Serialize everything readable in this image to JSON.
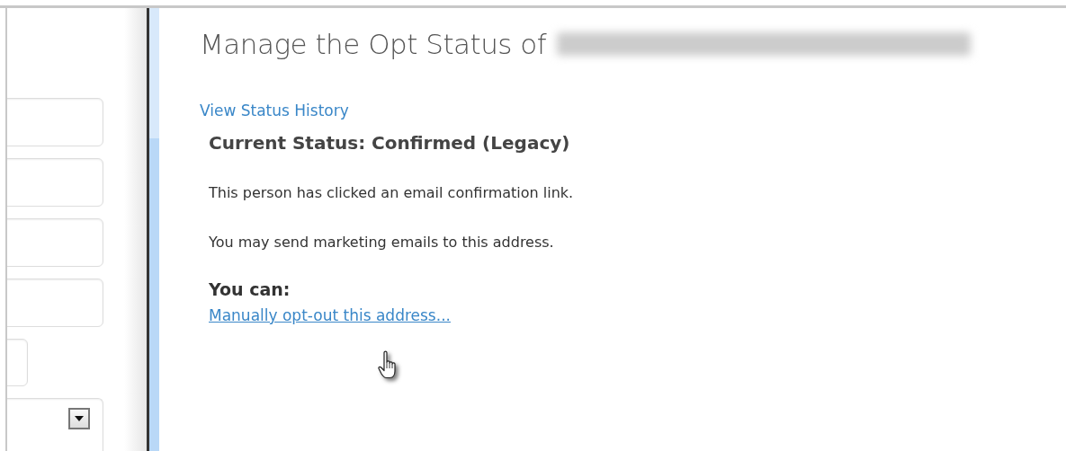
{
  "form_fields": [
    {
      "kind": "text"
    },
    {
      "kind": "text"
    },
    {
      "kind": "text"
    },
    {
      "kind": "text"
    },
    {
      "kind": "short"
    },
    {
      "kind": "select"
    }
  ],
  "panel": {
    "title": "Manage the Opt Status of",
    "history_link": "View Status History",
    "current_status": "Current Status: Confirmed (Legacy)",
    "messages": [
      "This person has clicked an email confirmation link.",
      "You may send marketing emails to this address."
    ],
    "actions_heading": "You can:",
    "action_link": "Manually opt-out this address..."
  }
}
